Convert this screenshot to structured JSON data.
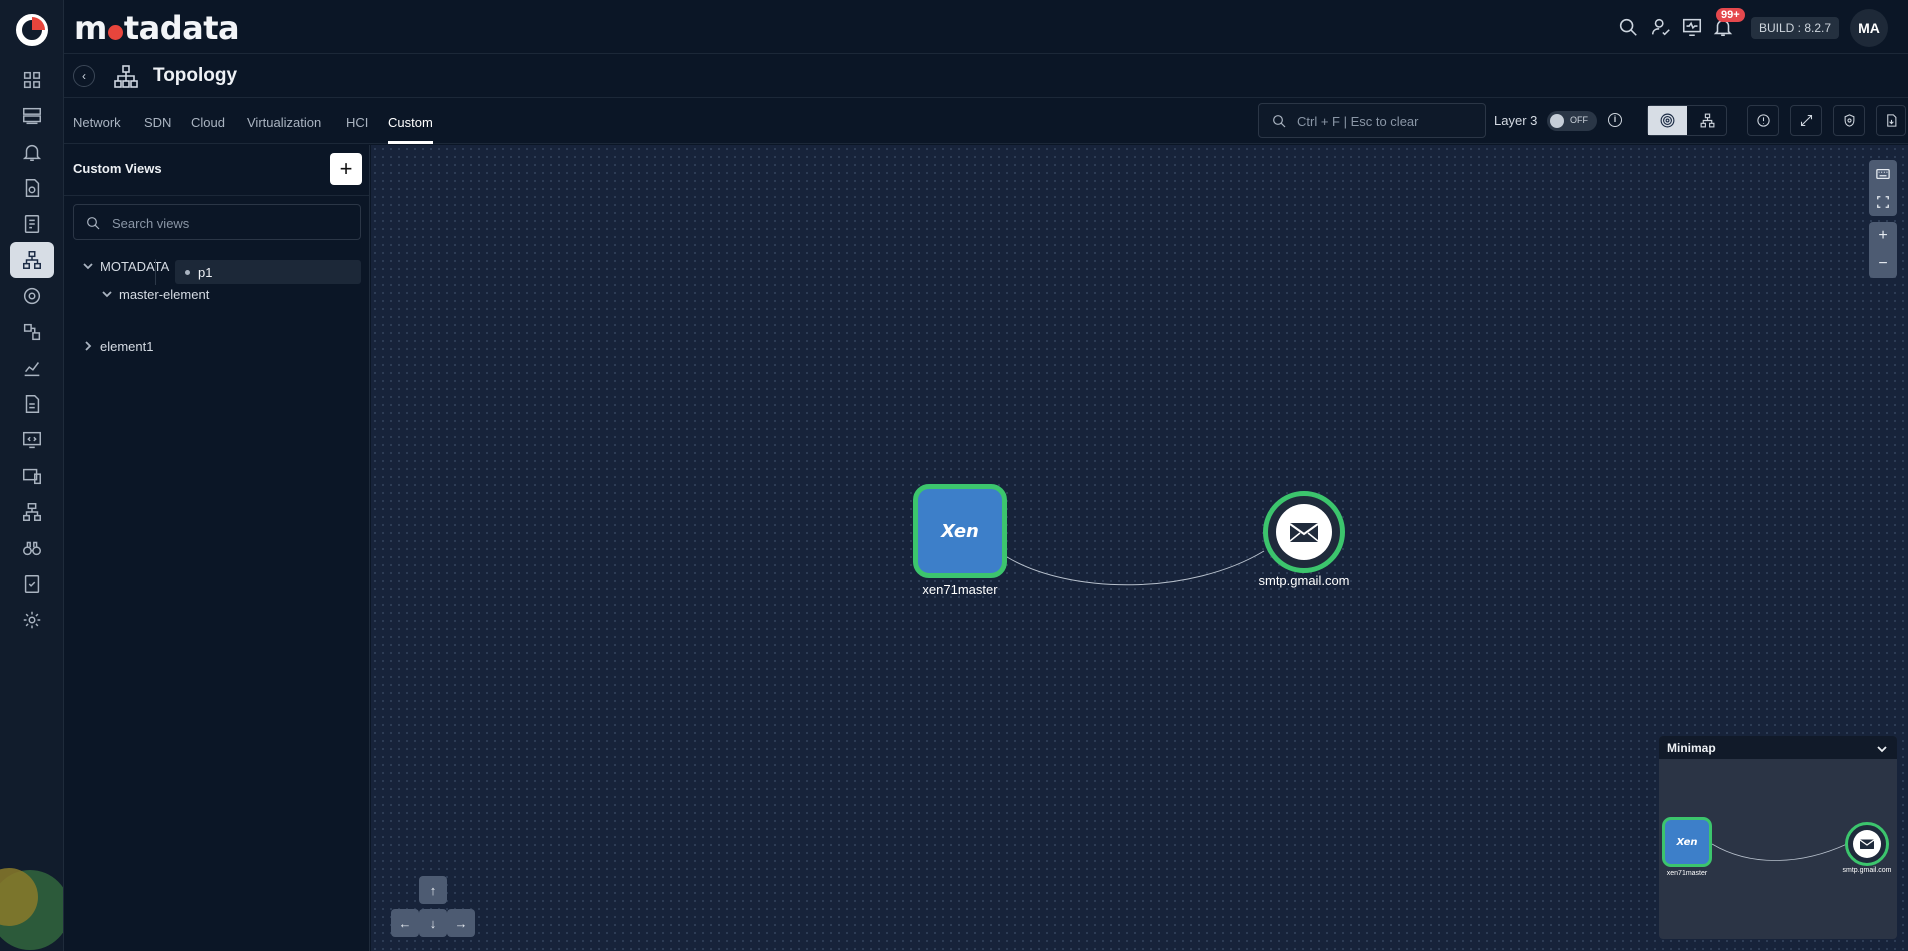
{
  "app": {
    "brand": "motadata",
    "build": "BUILD : 8.2.7",
    "notification_count": "99+",
    "user_initials": "MA"
  },
  "page": {
    "title": "Topology"
  },
  "tabs": [
    {
      "label": "Network"
    },
    {
      "label": "SDN"
    },
    {
      "label": "Cloud"
    },
    {
      "label": "Virtualization"
    },
    {
      "label": "HCI"
    },
    {
      "label": "Custom",
      "active": true
    }
  ],
  "toolbar": {
    "search_placeholder": "Ctrl + F | Esc to clear",
    "layer_label": "Layer 3",
    "layer_toggle_state": "OFF"
  },
  "panel": {
    "title": "Custom Views",
    "search_placeholder": "Search views",
    "tree": {
      "root": "MOTADATA",
      "child": "master-element",
      "leaf": "p1",
      "sibling": "element1"
    }
  },
  "canvas": {
    "nodes": [
      {
        "label": "xen71master",
        "type": "xen",
        "logo_text": "Xen",
        "status_color": "#3cc56d"
      },
      {
        "label": "smtp.gmail.com",
        "type": "mail",
        "status_color": "#3cc56d"
      }
    ],
    "zoom_in": "+",
    "zoom_out": "−"
  },
  "minimap": {
    "title": "Minimap"
  },
  "colors": {
    "accent_status": "#3cc56d",
    "alert_badge": "#e5484d",
    "canvas_bg": "#17233a"
  }
}
